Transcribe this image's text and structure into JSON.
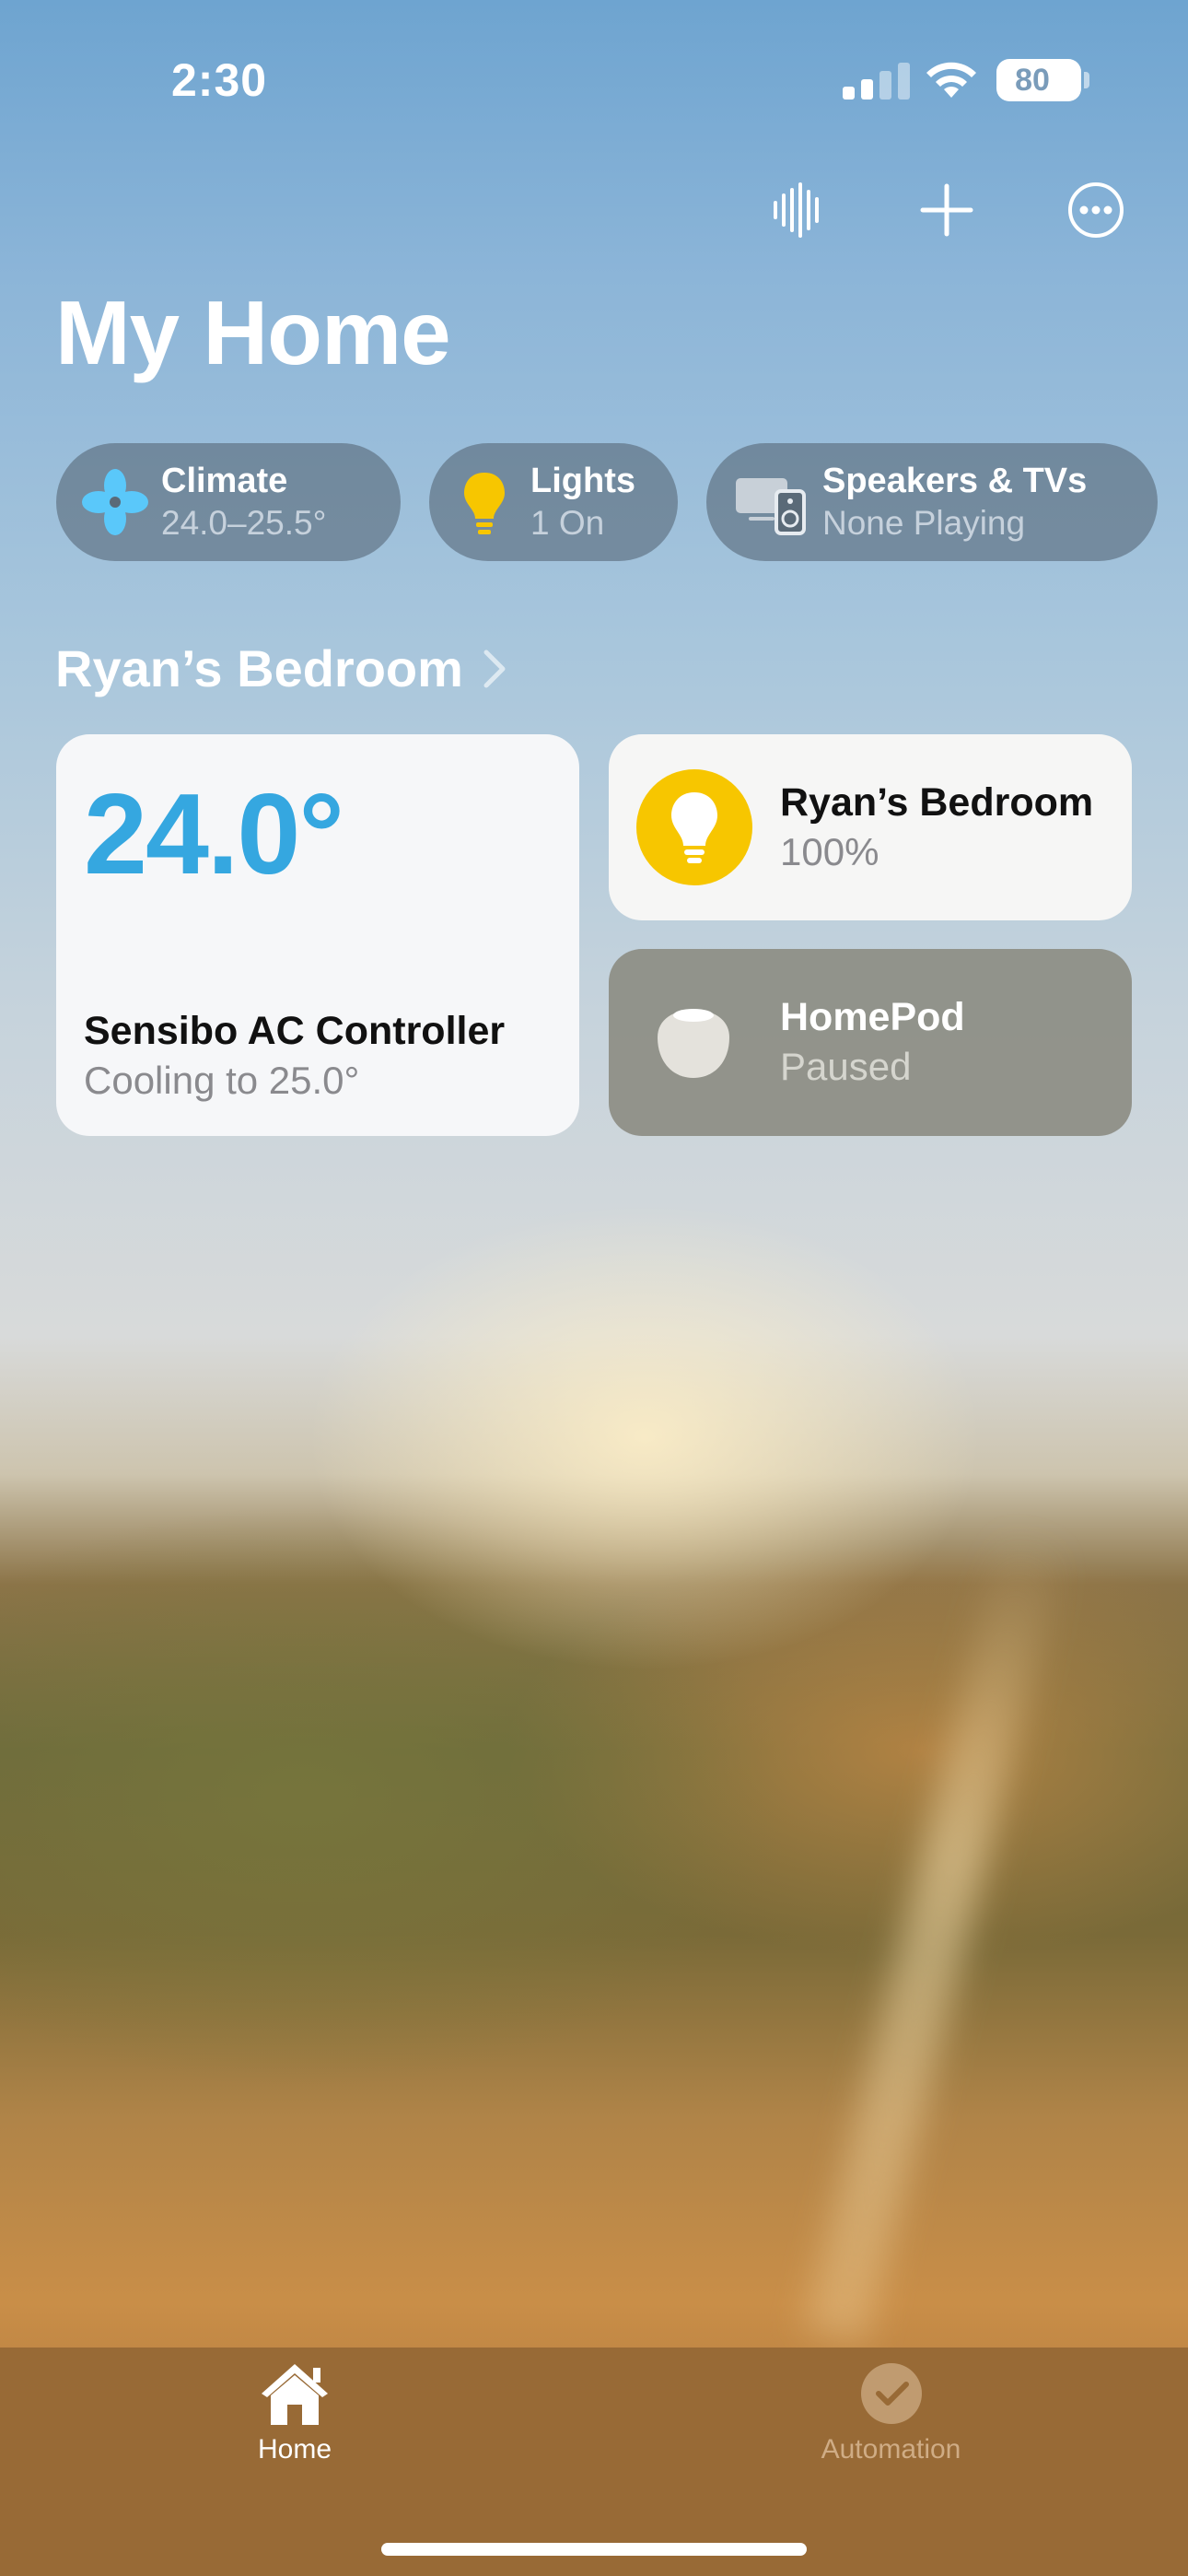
{
  "status_bar": {
    "time": "2:30",
    "battery": "80"
  },
  "toolbar": {
    "icons": [
      "waveform-icon",
      "plus-icon",
      "more-icon"
    ]
  },
  "title": "My Home",
  "categories": [
    {
      "name": "Climate",
      "detail": "24.0–25.5°",
      "icon": "fan-icon",
      "icon_color": "#5ac8fa"
    },
    {
      "name": "Lights",
      "detail": "1 On",
      "icon": "bulb-icon",
      "icon_color": "#f7c600"
    },
    {
      "name": "Speakers & TVs",
      "detail": "None Playing",
      "icon": "speaker-tv-icon"
    }
  ],
  "room": {
    "title": "Ryan’s Bedroom",
    "climate_tile": {
      "temperature": "24.0°",
      "name": "Sensibo AC Controller",
      "state": "Cooling to 25.0°",
      "accent": "#35a7e0"
    },
    "light_tile": {
      "name": "Ryan’s Bedroom",
      "state": "100%",
      "accent": "#f7c600"
    },
    "speaker_tile": {
      "name": "HomePod",
      "state": "Paused"
    }
  },
  "tabs": [
    {
      "label": "Home",
      "active": true
    },
    {
      "label": "Automation",
      "active": false
    }
  ]
}
